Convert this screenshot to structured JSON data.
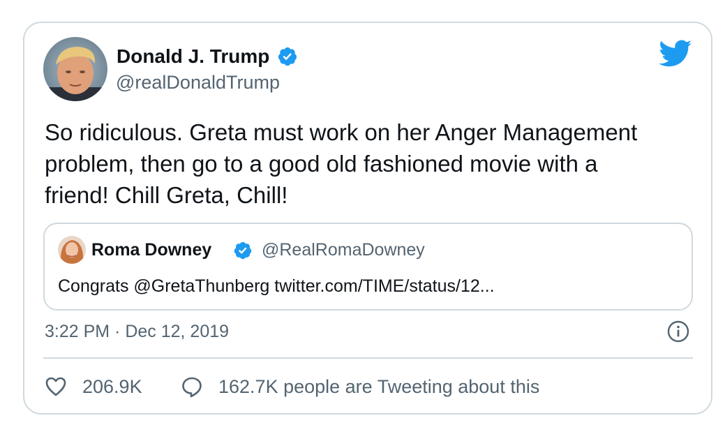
{
  "author": {
    "name": "Donald J. Trump",
    "handle": "@realDonaldTrump",
    "avatar_icon": "profile-photo",
    "verified_icon": "verified-badge-icon"
  },
  "tweet": {
    "text": "So ridiculous. Greta must work on her Anger Management\nproblem, then go to a good old fashioned movie with a\nfriend! Chill Greta, Chill!",
    "timestamp": "3:22 PM · Dec 12, 2019"
  },
  "quoted_tweet": {
    "name": "Roma Downey",
    "handle": "@RealRomaDowney",
    "text": "Congrats @GretaThunberg twitter.com/TIME/status/12..."
  },
  "stats": {
    "likes": "206.9K",
    "tweeting_text": "162.7K people are Tweeting about this"
  },
  "icons": {
    "brand": "twitter-bird-icon",
    "info": "info-icon",
    "like": "heart-icon",
    "reply": "speech-bubble-icon"
  },
  "colors": {
    "brand_blue": "#1d9bf0",
    "text_primary": "#0f1419",
    "text_secondary": "#536471",
    "border": "#cfd9de"
  }
}
